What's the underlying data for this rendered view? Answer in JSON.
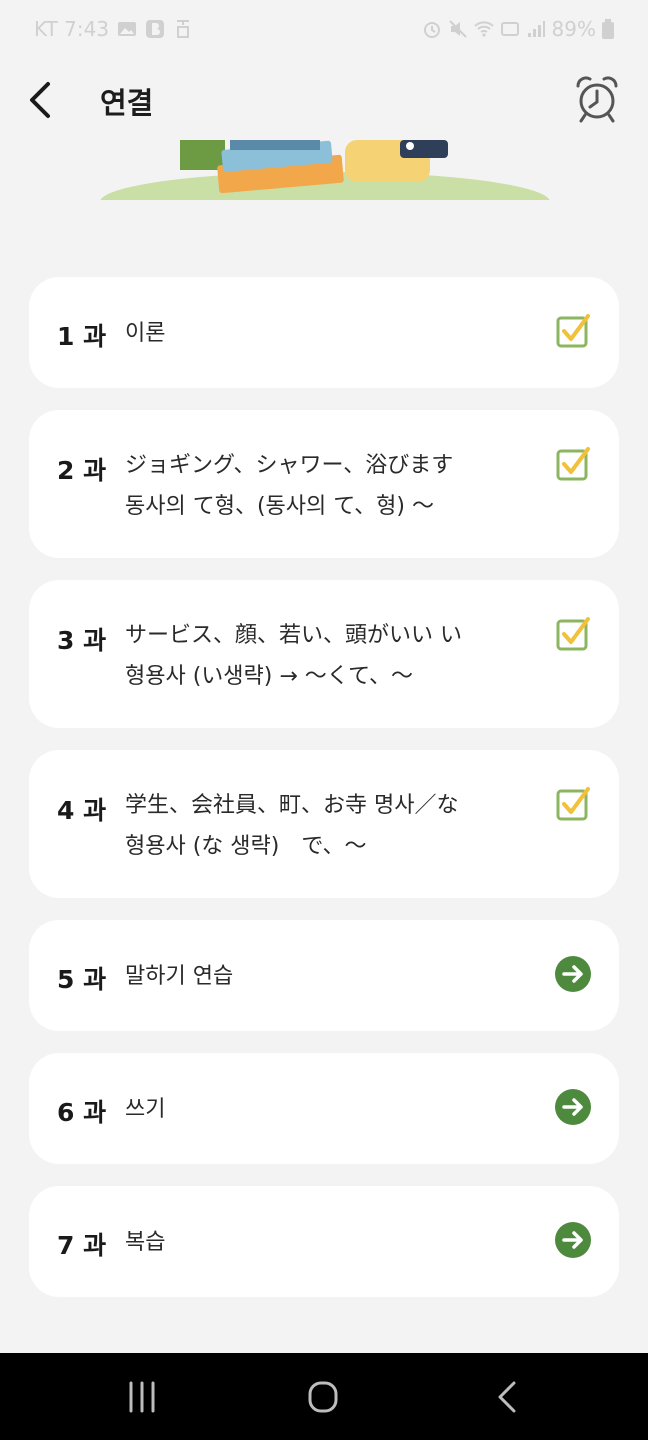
{
  "status_bar": {
    "carrier_time": "KT 7:43",
    "battery": "89%"
  },
  "header": {
    "title": "연결",
    "back_icon": "chevron-left-icon",
    "alarm_icon": "alarm-clock-icon"
  },
  "colors": {
    "accent_green": "#4e8a3e",
    "check_green": "#8cb55f",
    "check_yellow": "#f2c13b",
    "card_bg": "#ffffff",
    "page_bg": "#f3f3f3"
  },
  "lessons": [
    {
      "num": "1 과",
      "line1": "이론",
      "line2": "",
      "status": "completed"
    },
    {
      "num": "2 과",
      "line1": "ジョギング、シャワー、浴びます",
      "line2": "동사의 て형、(동사의 て、형) 〜",
      "status": "completed"
    },
    {
      "num": "3 과",
      "line1": "サービス、顔、若い、頭がいい い",
      "line2": "형용사 (い생략) → 〜くて、〜",
      "status": "completed"
    },
    {
      "num": "4 과",
      "line1": "学生、会社員、町、お寺 명사／な",
      "line2": "형용사 (な 생략)　で、〜",
      "status": "completed"
    },
    {
      "num": "5 과",
      "line1": "말하기 연습",
      "line2": "",
      "status": "go"
    },
    {
      "num": "6 과",
      "line1": "쓰기",
      "line2": "",
      "status": "go"
    },
    {
      "num": "7 과",
      "line1": "복습",
      "line2": "",
      "status": "go"
    }
  ],
  "nav": {
    "recent_icon": "recent-apps-icon",
    "home_icon": "home-icon",
    "back_icon": "back-icon"
  }
}
